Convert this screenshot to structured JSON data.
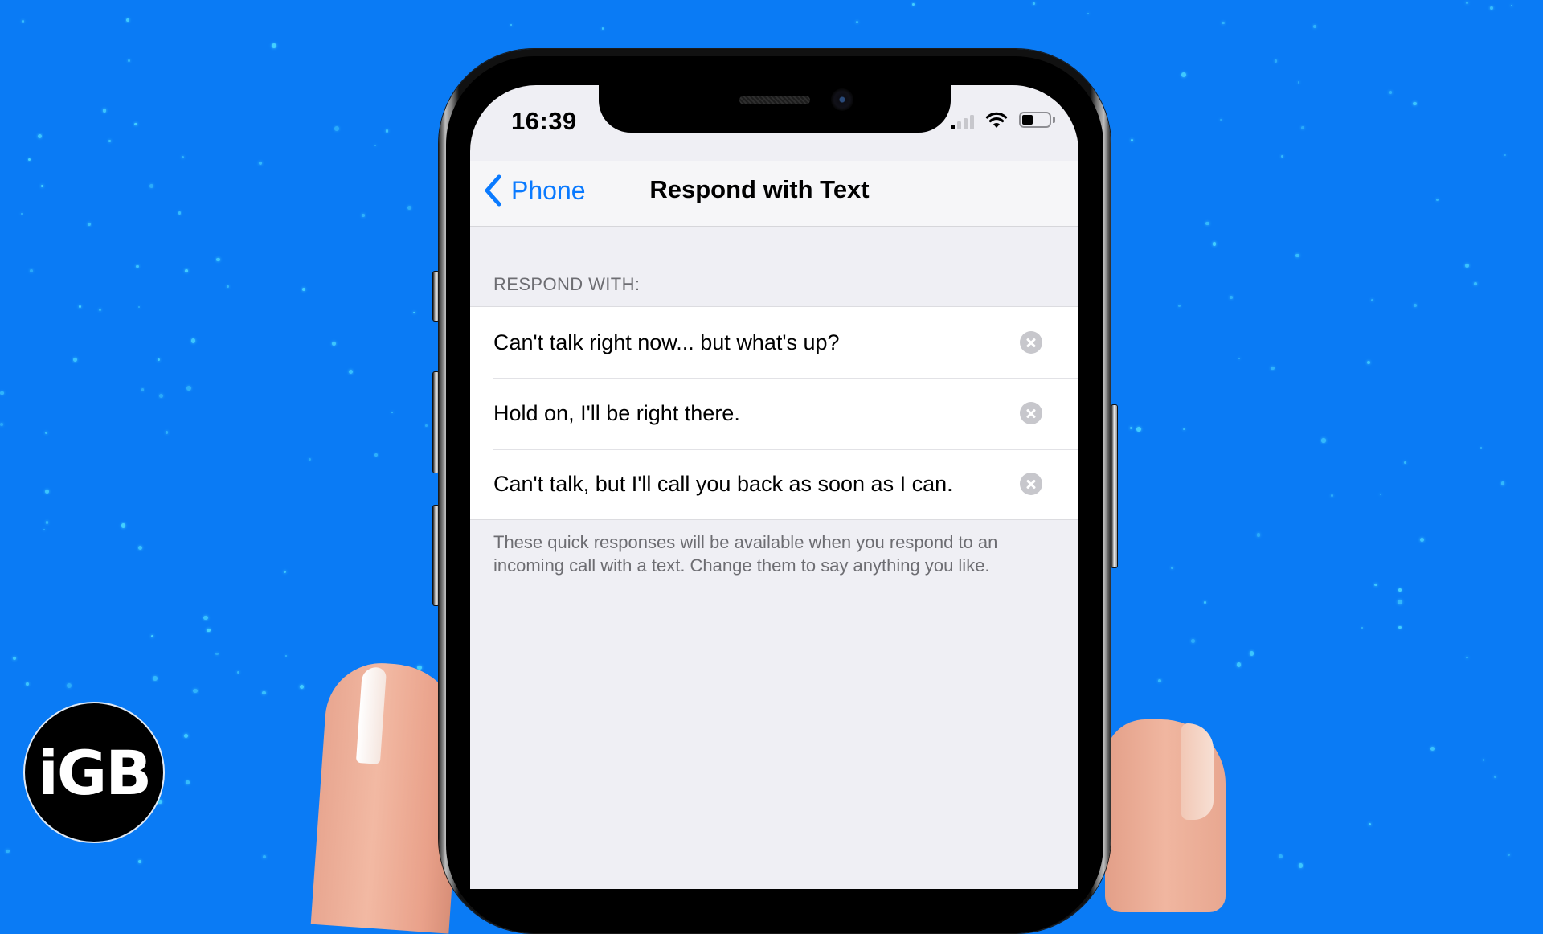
{
  "colors": {
    "background": "#0a7bf5",
    "star": "#45d2ff",
    "accent": "#0a7aff",
    "screen_bg": "#efeff4",
    "secondary_text": "#6d6d72"
  },
  "status_bar": {
    "time": "16:39",
    "signal_bars_active": 1,
    "signal_bars_total": 4,
    "wifi_icon": "wifi-icon",
    "battery_level": 0.4
  },
  "nav": {
    "back_icon": "chevron-left-icon",
    "back_label": "Phone",
    "title": "Respond with Text"
  },
  "section": {
    "header": "RESPOND WITH:",
    "responses": [
      {
        "text": "Can't talk right now... but what's up?",
        "clear_icon": "clear-icon"
      },
      {
        "text": "Hold on, I'll be right there.",
        "clear_icon": "clear-icon"
      },
      {
        "text": "Can't talk, but I'll call you back as soon as I can.",
        "clear_icon": "clear-icon"
      }
    ],
    "footer": "These quick responses will be available when you respond to an incoming call with a text. Change them to say anything you like."
  },
  "watermark": {
    "logo_text": "iGB"
  }
}
